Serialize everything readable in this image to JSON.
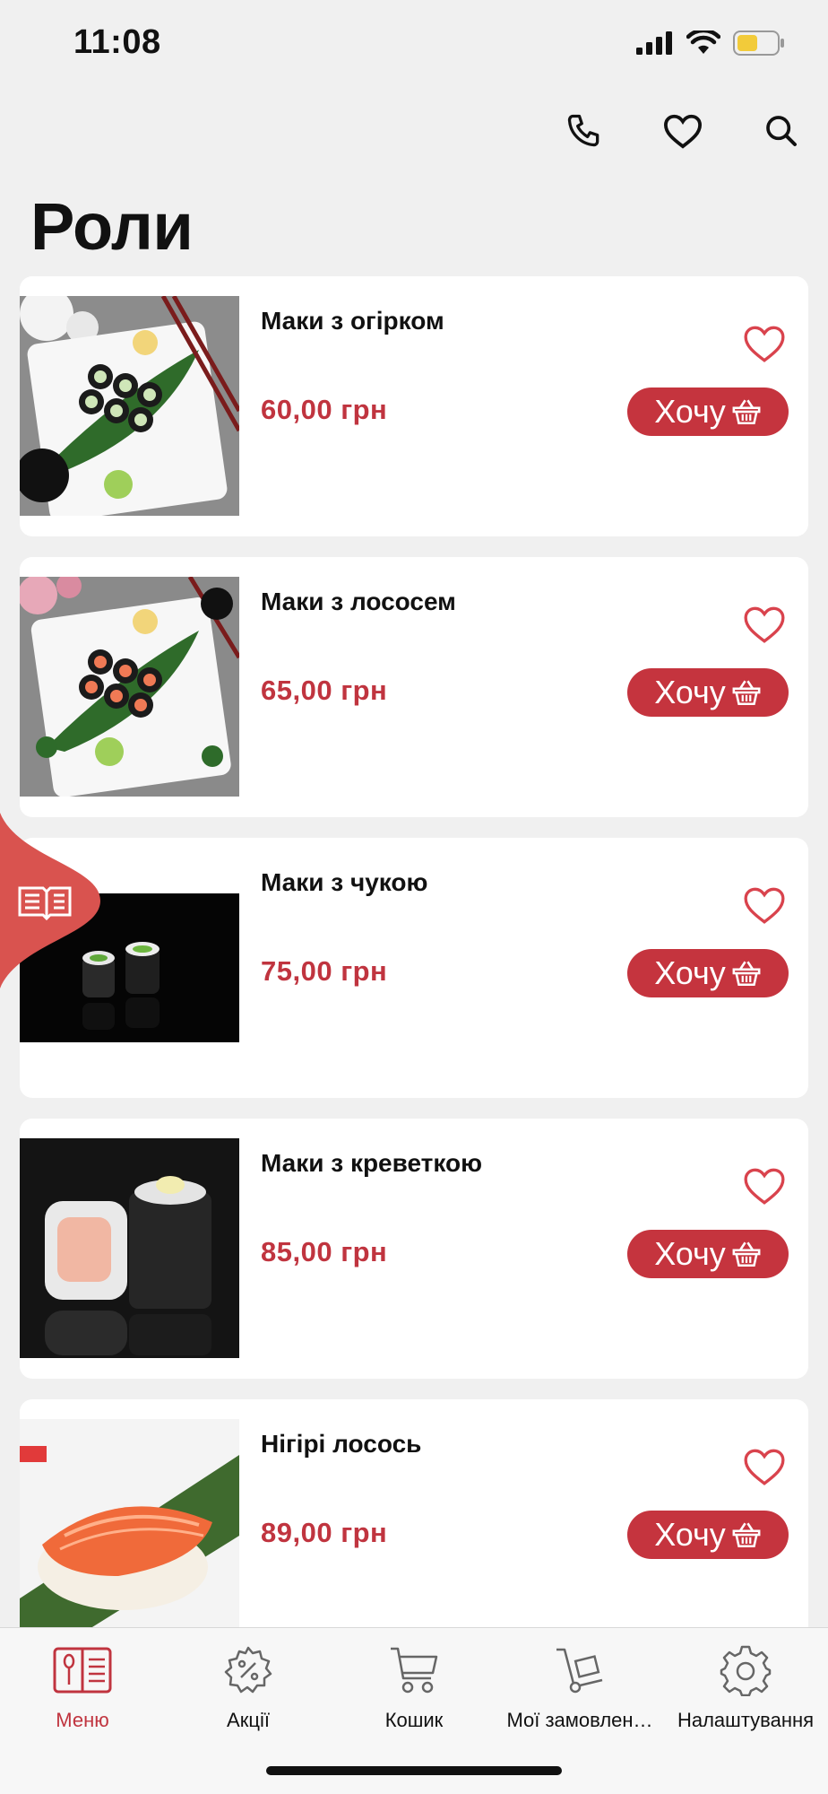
{
  "status_bar": {
    "time": "11:08"
  },
  "header": {
    "title": "Роли"
  },
  "products": [
    {
      "name": "Маки з огірком",
      "price": "60,00 грн",
      "action": "Хочу"
    },
    {
      "name": "Маки з лососем",
      "price": "65,00 грн",
      "action": "Хочу"
    },
    {
      "name": "Маки з чукою",
      "price": "75,00 грн",
      "action": "Хочу"
    },
    {
      "name": "Маки з креветкою",
      "price": "85,00 грн",
      "action": "Хочу"
    },
    {
      "name": "Нігірі лосось",
      "price": "89,00 грн",
      "action": "Хочу"
    }
  ],
  "tab_bar": {
    "items": [
      {
        "label": "Меню",
        "icon": "menu-book-icon",
        "active": true
      },
      {
        "label": "Акції",
        "icon": "discount-gear-icon",
        "active": false
      },
      {
        "label": "Кошик",
        "icon": "cart-icon",
        "active": false
      },
      {
        "label": "Мої замовлен…",
        "icon": "hand-truck-icon",
        "active": false
      },
      {
        "label": "Налаштування",
        "icon": "settings-gear-icon",
        "active": false
      }
    ]
  },
  "colors": {
    "accent": "#c5343e",
    "price": "#c0343f",
    "background": "#f0f0f0",
    "side_tab": "#d9534f"
  }
}
